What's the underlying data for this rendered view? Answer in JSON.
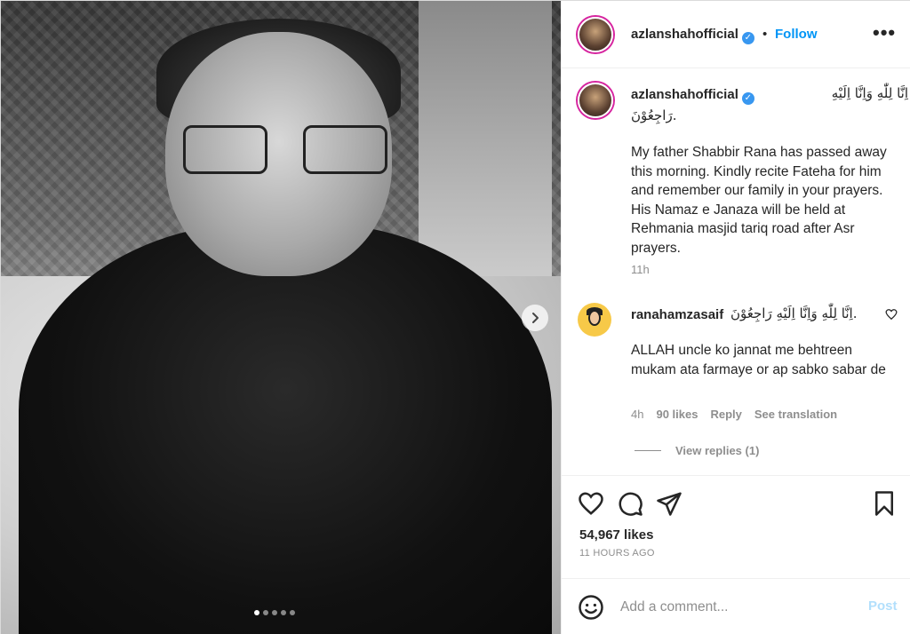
{
  "post": {
    "username": "azlanshahofficial",
    "verified_icon": "verified-badge-icon",
    "follow_label": "Follow",
    "separator": "•",
    "more_label": "•••",
    "image_count": 5,
    "image_active_index": 0
  },
  "caption": {
    "username": "azlanshahofficial",
    "arabic_line1": "اِنَّا لِلّٰهِ وَاِنَّا اِلَيْهِ",
    "arabic_line2": "رَاجِعُوْنَ.",
    "body": "My father Shabbir Rana has passed away this morning. Kindly recite Fateha for him and remember our family in your prayers. His Namaz e Janaza will be held at Rehmania masjid tariq road after Asr prayers.",
    "time": "11h"
  },
  "comment": {
    "username": "ranahamzasaif",
    "arabic": ".اِنَّا لِلّٰهِ وَاِنَّا اِلَيْهِ رَاجِعُوْنَ",
    "text": "ALLAH uncle ko jannat me behtreen mukam ata farmaye or ap sabko sabar de",
    "time": "4h",
    "likes": "90 likes",
    "reply_label": "Reply",
    "see_translation_label": "See translation",
    "view_replies_label": "View replies (1)"
  },
  "actions": {
    "likes": "54,967 likes",
    "posted_ago": "11 HOURS AGO"
  },
  "add_comment": {
    "placeholder": "Add a comment...",
    "post_label": "Post"
  },
  "colors": {
    "accent": "#0095f6",
    "post_disabled": "#b2dffc",
    "muted": "#8e8e8e",
    "text": "#262626"
  }
}
